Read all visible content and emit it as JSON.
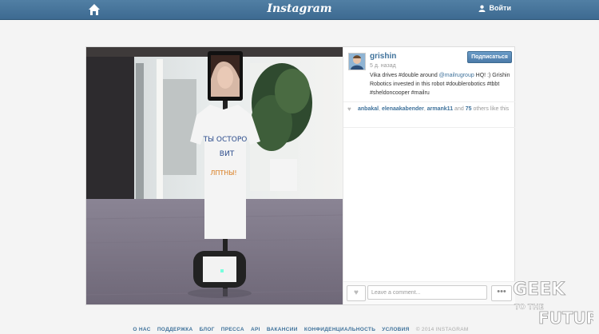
{
  "header": {
    "logo": "Instagram",
    "login": "Войти"
  },
  "post": {
    "username": "grishin",
    "time": "5 д. назад",
    "follow_label": "Подписаться",
    "caption_pre": "Vika drives #double around ",
    "caption_mention": "@mailrugroup",
    "caption_post": " HQ! :) Grishin Robotics invested in this robot #doublerobotics #tbbt #sheldoncooper #mailru",
    "likes": {
      "names": [
        "anbakal",
        "elenaakabender",
        "armank11"
      ],
      "and": "and",
      "count": "75",
      "tail": "others like this"
    },
    "comment_placeholder": "Leave a comment...",
    "more_label": "•••",
    "shirt_text": [
      "ТЫ ОСТОРО",
      "ВИТ",
      "ЛПТНЫ!"
    ]
  },
  "footer": {
    "links": [
      "О НАС",
      "ПОДДЕРЖКА",
      "БЛОГ",
      "ПРЕССА",
      "API",
      "ВАКАНСИИ",
      "КОНФИДЕНЦИАЛЬНОСТЬ",
      "УСЛОВИЯ"
    ],
    "copyright": "© 2014 INSTAGRAM"
  },
  "watermark": {
    "line1": "GEEK",
    "line2": "TO THE",
    "line3": "FUTURE"
  }
}
